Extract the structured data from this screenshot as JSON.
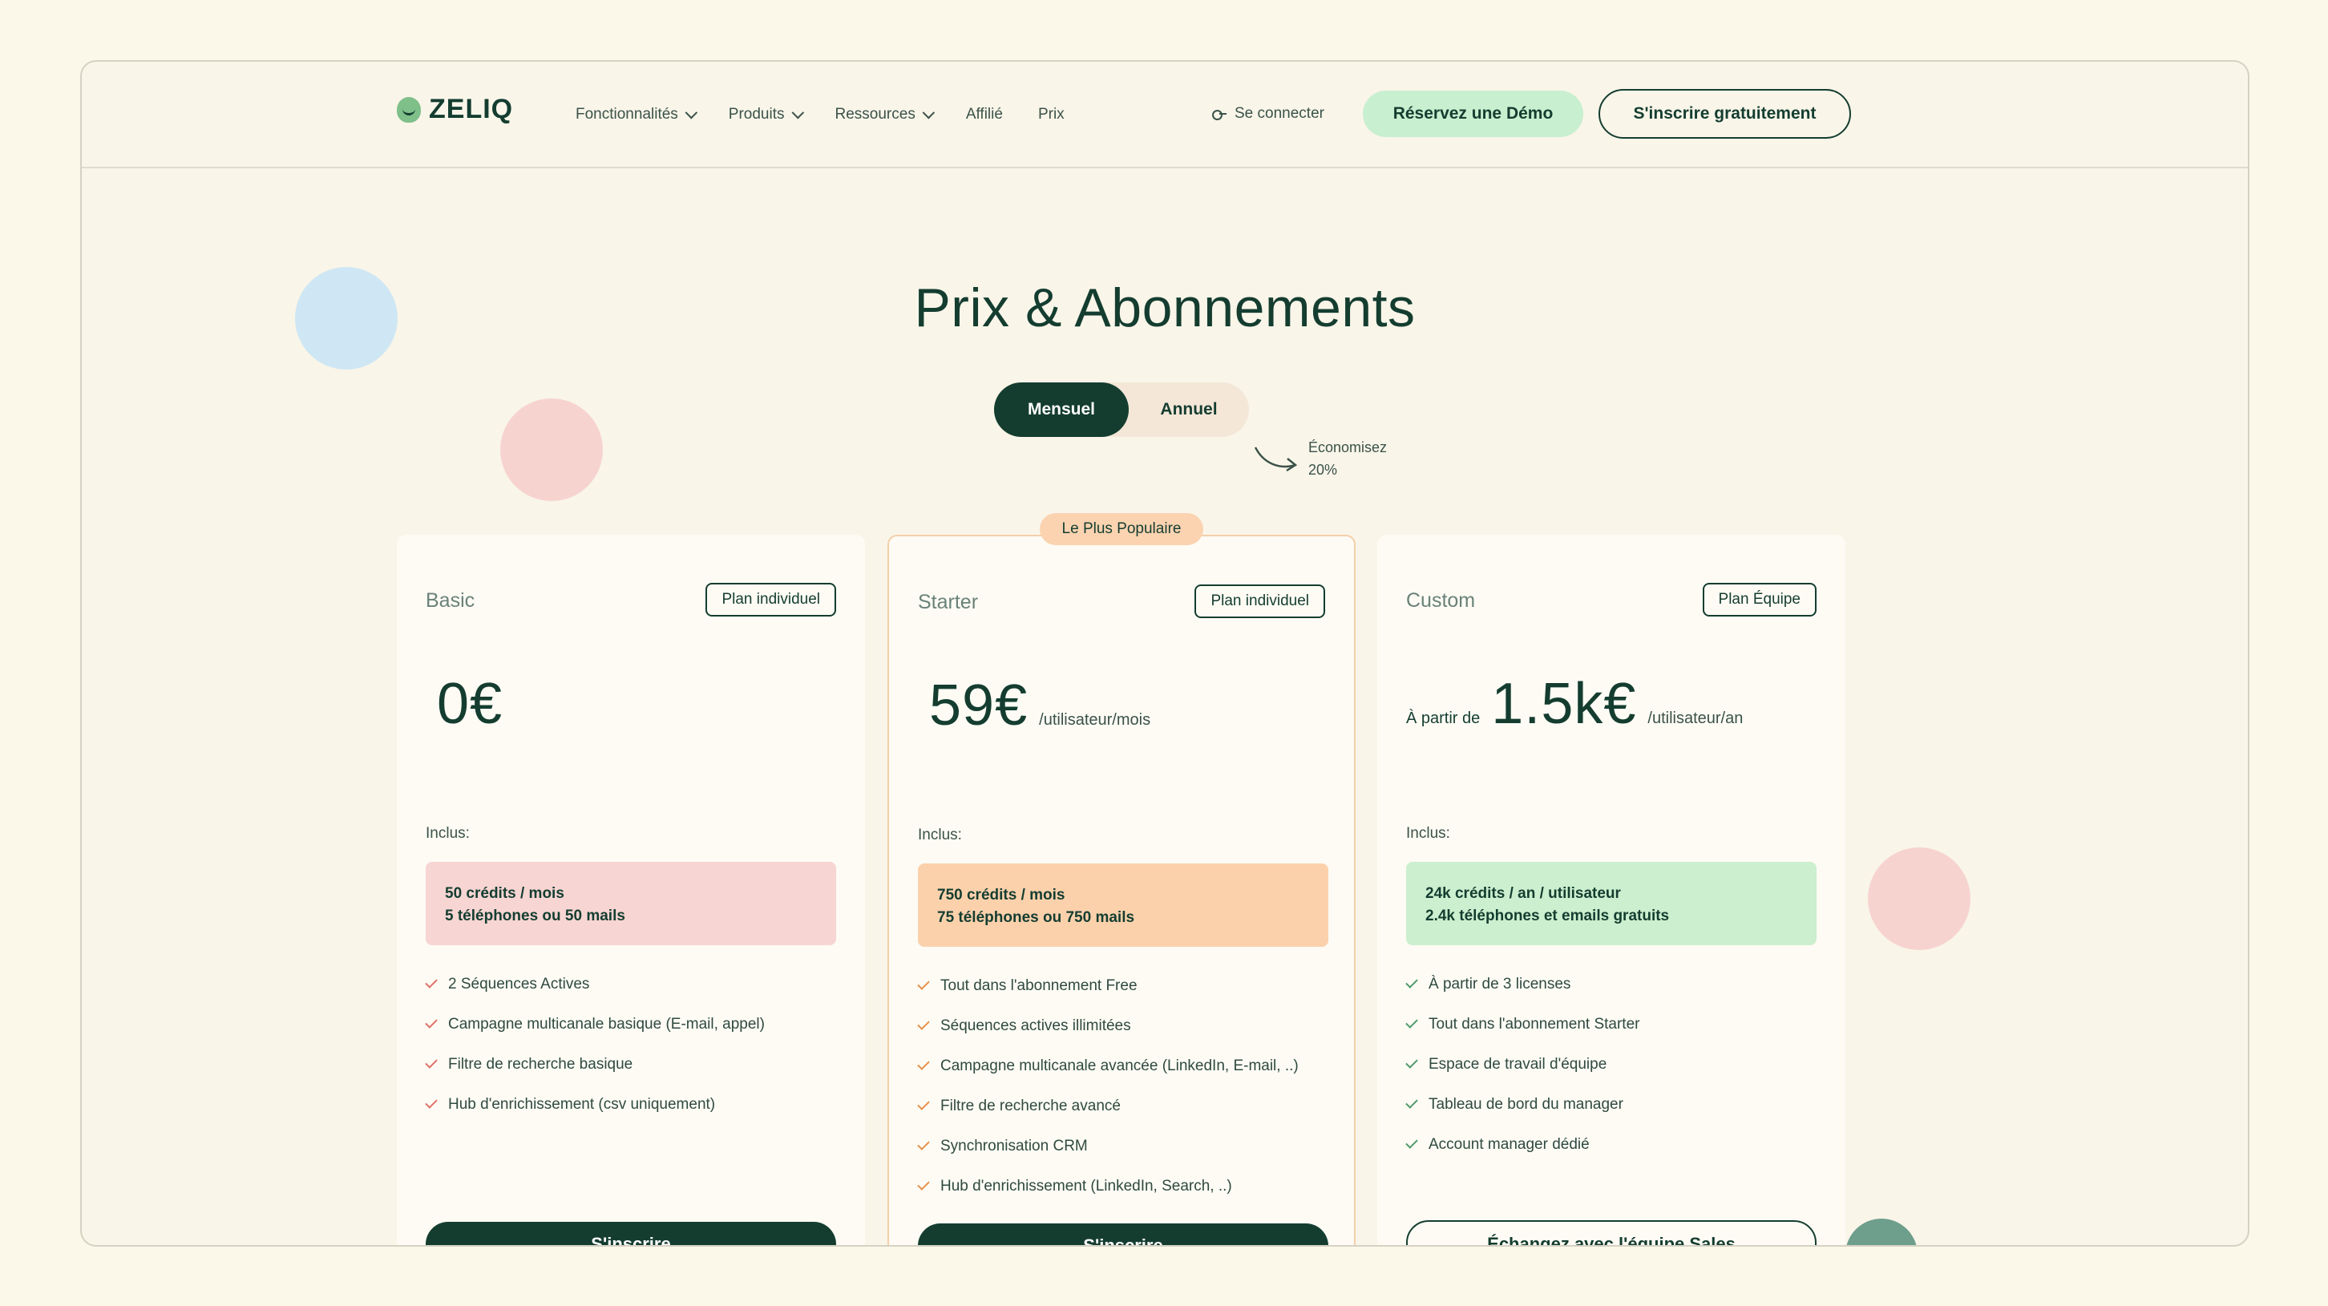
{
  "brand": {
    "name": "ZELIQ",
    "accent": "#143d30"
  },
  "nav": {
    "items": [
      {
        "label": "Fonctionnalités",
        "dropdown": true
      },
      {
        "label": "Produits",
        "dropdown": true
      },
      {
        "label": "Ressources",
        "dropdown": true
      },
      {
        "label": "Affilié",
        "dropdown": false
      },
      {
        "label": "Prix",
        "dropdown": false
      }
    ],
    "login": "Se connecter",
    "demo": "Réservez une Démo",
    "signup": "S'inscrire gratuitement"
  },
  "hero": {
    "title": "Prix & Abonnements",
    "toggle": {
      "monthly": "Mensuel",
      "annual": "Annuel",
      "selected": "Mensuel"
    },
    "save_line1": "Économisez",
    "save_line2": "20%"
  },
  "popular_badge": "Le Plus Populaire",
  "plans": [
    {
      "name": "Basic",
      "type": "Plan individuel",
      "price_prefix": "",
      "price": "0€",
      "price_unit": "",
      "included": "Inclus:",
      "credits_line1": "50 crédits / mois",
      "credits_line2": "5 téléphones ou 50 mails",
      "credits_color": "#f7d5d3",
      "check_color": "#e0706a",
      "features": [
        "2 Séquences Actives",
        "Campagne multicanale basique (E-mail, appel)",
        "Filtre de recherche basique",
        "Hub d'enrichissement (csv uniquement)"
      ],
      "cta": "S'inscrire"
    },
    {
      "name": "Starter",
      "type": "Plan individuel",
      "price_prefix": "",
      "price": "59€",
      "price_unit": "/utilisateur/mois",
      "included": "Inclus:",
      "credits_line1": "750 crédits / mois",
      "credits_line2": "75 téléphones ou 750 mails",
      "credits_color": "#fbd1ac",
      "check_color": "#e8904a",
      "features": [
        "Tout dans l'abonnement Free",
        "Séquences actives illimitées",
        "Campagne multicanale avancée (LinkedIn, E-mail, ..)",
        "Filtre de recherche avancé",
        "Synchronisation CRM",
        "Hub d'enrichissement (LinkedIn, Search, ..)"
      ],
      "cta": "S'inscrire"
    },
    {
      "name": "Custom",
      "type": "Plan Équipe",
      "price_prefix": "À partir de",
      "price": "1.5k€",
      "price_unit": "/utilisateur/an",
      "included": "Inclus:",
      "credits_line1": "24k crédits / an / utilisateur",
      "credits_line2": "2.4k téléphones et emails gratuits",
      "credits_color": "#ccefcf",
      "check_color": "#4f9a6a",
      "features": [
        "À partir de 3 licenses",
        "Tout dans l'abonnement Starter",
        "Espace de travail d'équipe",
        "Tableau de bord du manager",
        "Account manager dédié"
      ],
      "cta": "Échangez avec l'équipe Sales"
    }
  ]
}
